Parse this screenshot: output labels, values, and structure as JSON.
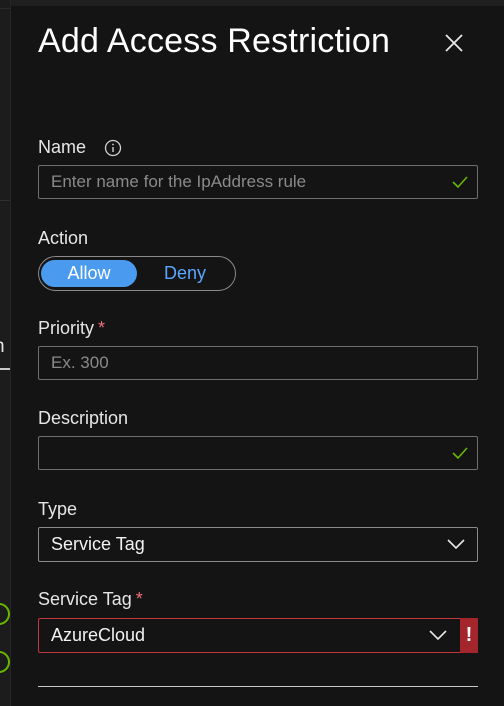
{
  "panel": {
    "title": "Add Access Restriction"
  },
  "fields": {
    "name": {
      "label": "Name",
      "value": "",
      "placeholder": "Enter name for the IpAddress rule"
    },
    "action": {
      "label": "Action",
      "options": [
        "Allow",
        "Deny"
      ],
      "selected": "Allow"
    },
    "priority": {
      "label": "Priority",
      "required_mark": "*",
      "value": "",
      "placeholder": "Ex. 300"
    },
    "description": {
      "label": "Description",
      "value": "",
      "placeholder": ""
    },
    "type": {
      "label": "Type",
      "value": "Service Tag"
    },
    "service_tag": {
      "label": "Service Tag",
      "required_mark": "*",
      "value": "AzureCloud",
      "error_mark": "!"
    }
  },
  "background": {
    "peek_text": "n"
  },
  "icons": {
    "close": "close-icon",
    "info": "info-icon",
    "check": "checkmark-icon",
    "chevron": "chevron-down-icon"
  },
  "colors": {
    "accent": "#4a9bf0",
    "success": "#6bb700",
    "error": "#a4262c",
    "required": "#f1707b"
  }
}
